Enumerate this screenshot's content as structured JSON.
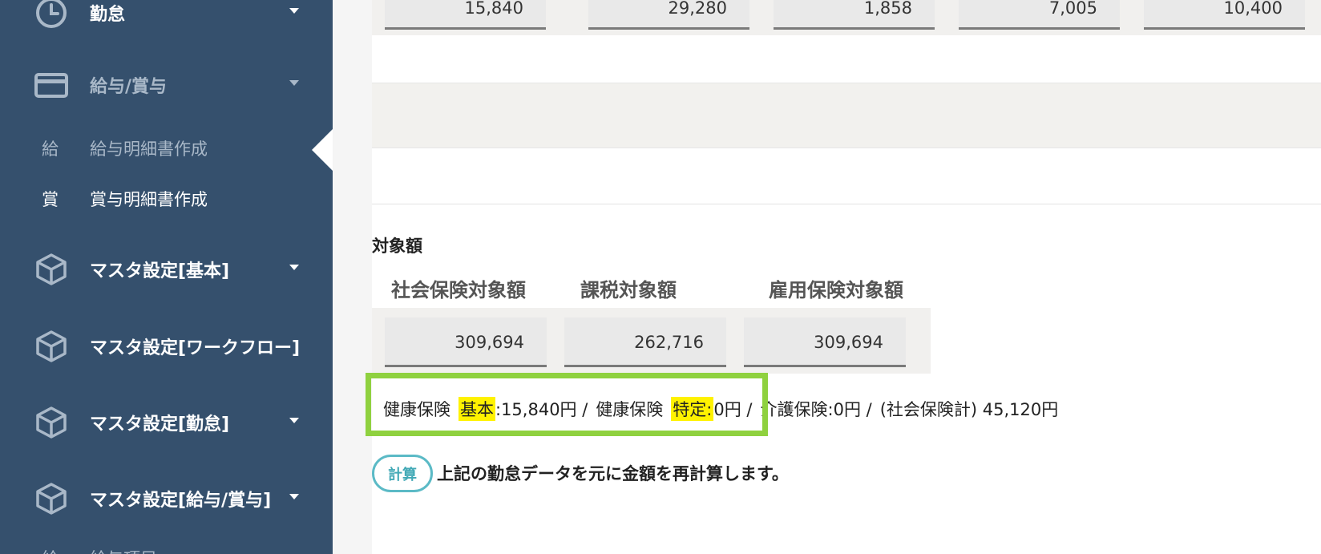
{
  "sidebar": {
    "items": [
      {
        "label": "勤怠",
        "icon": "clock-icon"
      },
      {
        "label": "給与/賞与",
        "icon": "card-icon"
      },
      {
        "label": "マスタ設定[基本]",
        "icon": "box-icon"
      },
      {
        "label": "マスタ設定[ワークフロー]",
        "icon": "box-icon"
      },
      {
        "label": "マスタ設定[勤怠]",
        "icon": "box-icon"
      },
      {
        "label": "マスタ設定[給与/賞与]",
        "icon": "box-icon"
      }
    ],
    "subitems": [
      {
        "abbr": "給",
        "label": "給与明細書作成"
      },
      {
        "abbr": "賞",
        "label": "賞与明細書作成"
      },
      {
        "abbr": "給",
        "label": "給与項目"
      }
    ]
  },
  "top_values": [
    "15,840",
    "29,280",
    "1,858",
    "7,005",
    "10,400"
  ],
  "target": {
    "section_title": "対象額",
    "headers": [
      "社会保険対象額",
      "課税対象額",
      "雇用保険対象額"
    ],
    "values": [
      "309,694",
      "262,716",
      "309,694"
    ]
  },
  "summary": {
    "kenko_prefix": "健康保険",
    "kihon_label": "基本",
    "kihon_value": ":15,840円 /",
    "kenko_prefix2": "健康保険",
    "tokutei_label": "特定:",
    "tokutei_value": "0円 /",
    "kaigo": "介護保険:0円 /",
    "total": "(社会保険計) 45,120円"
  },
  "calc": {
    "button_label": "計算",
    "note": "上記の勤怠データを元に金額を再計算します。"
  },
  "colors": {
    "sidebar_bg": "#35506d",
    "highlight": "#fff200",
    "frame": "#8fd13f",
    "accent": "#5bbac6"
  }
}
